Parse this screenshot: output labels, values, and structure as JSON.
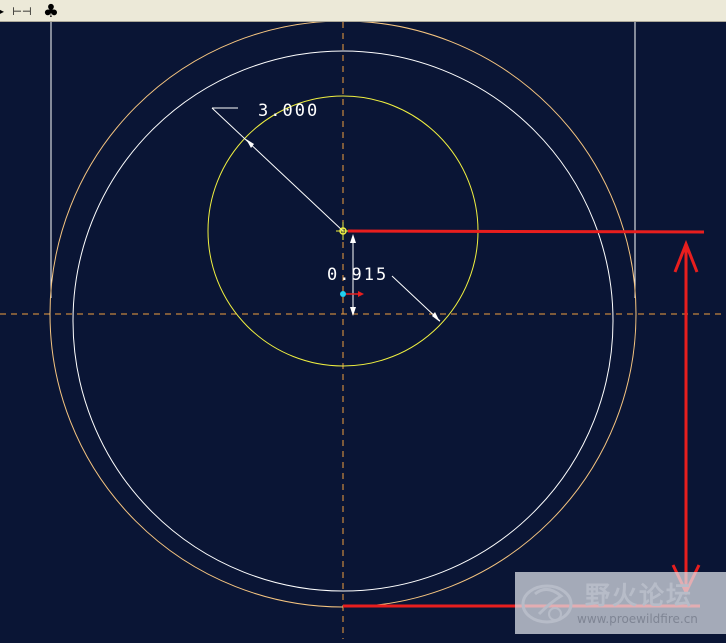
{
  "toolbar": {
    "buttons": [
      {
        "name": "dimension-tool",
        "glyph": "⊢⊣"
      },
      {
        "name": "constraint-tool",
        "glyph": "♣"
      }
    ]
  },
  "sketch": {
    "dimensions": {
      "diameter_label": "3.000",
      "offset_label": "0.915"
    }
  },
  "watermark": {
    "title": "野火论坛",
    "url": "www.proewildfire.cn"
  },
  "colors": {
    "background": "#0a1535",
    "centerline": "#f0a040",
    "geometry": "#ffffff",
    "selected": "#f0f040",
    "annotation": "#e81e1e",
    "toolbar": "#ece9d8"
  }
}
